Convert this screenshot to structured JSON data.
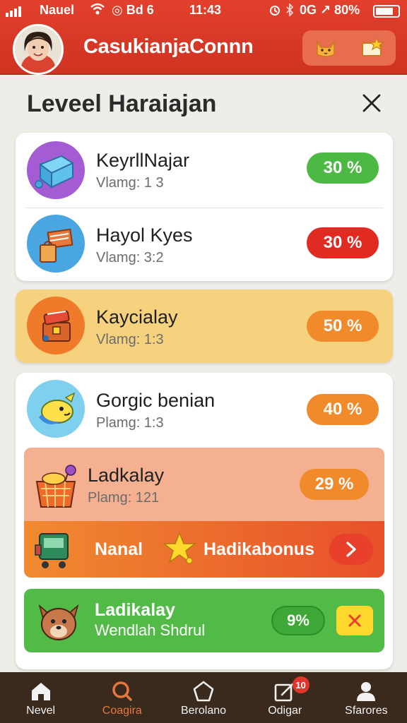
{
  "status": {
    "carrier": "Nauel",
    "extra": "◎ Bd 6",
    "time": "11:43",
    "right_text": "0G ↗ 80%"
  },
  "header": {
    "title": "CasukianjaConnn"
  },
  "page": {
    "title": "Leveel Haraiajan"
  },
  "items": [
    {
      "name": "KeyrllNajar",
      "sub": "Vlamg: 1 3",
      "badge": "30 %",
      "badge_color": "#4cb944"
    },
    {
      "name": "Hayol Kyes",
      "sub": "Vlamg: 3:2",
      "badge": "30 %",
      "badge_color": "#e02a22"
    },
    {
      "name": "Kaycialay",
      "sub": "Vlamg: 1:3",
      "badge": "50 %",
      "badge_color": "#f08a2a"
    },
    {
      "name": "Gorgic benian",
      "sub": "Plamg: 1:3",
      "badge": "40 %",
      "badge_color": "#f08a2a"
    },
    {
      "name": "Ladkalay",
      "sub": "Plamg: 121",
      "badge": "29 %",
      "badge_color": "#f08a2a"
    }
  ],
  "bonus": {
    "left": "Nanal",
    "right": "Hadikabonus"
  },
  "green_card": {
    "name": "Ladikalay",
    "sub": "Wendlah Shdrul",
    "badge": "9%"
  },
  "tabs": [
    {
      "label": "Nevel",
      "icon": "home-icon"
    },
    {
      "label": "Coagira",
      "icon": "search-icon"
    },
    {
      "label": "Berolano",
      "icon": "pentagon-icon"
    },
    {
      "label": "Odigar",
      "icon": "edit-icon",
      "badge": "10"
    },
    {
      "label": "Sfarores",
      "icon": "person-icon"
    }
  ],
  "colors": {
    "header": "#d8392a",
    "tab_active": "#e8773a",
    "tabbar": "#3a2a1e"
  }
}
